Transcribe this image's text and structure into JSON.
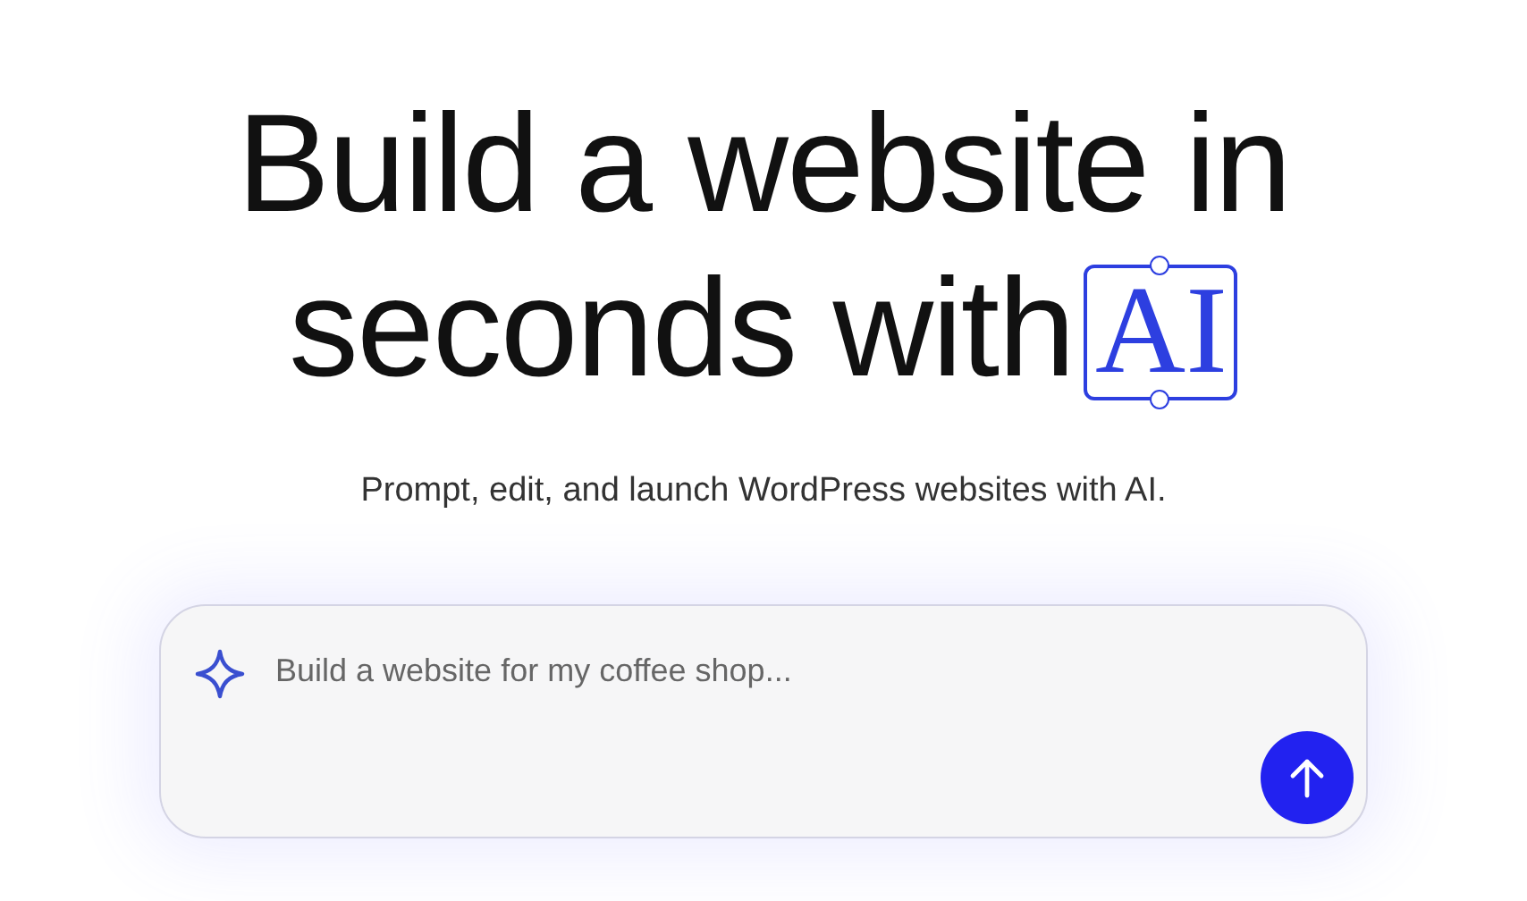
{
  "headline": {
    "line_1": "Build a website in",
    "line_2": "seconds with",
    "badge": "AI"
  },
  "subtitle": "Prompt, edit, and launch WordPress websites with AI.",
  "prompt": {
    "placeholder": "Build a website for my coffee shop..."
  }
}
